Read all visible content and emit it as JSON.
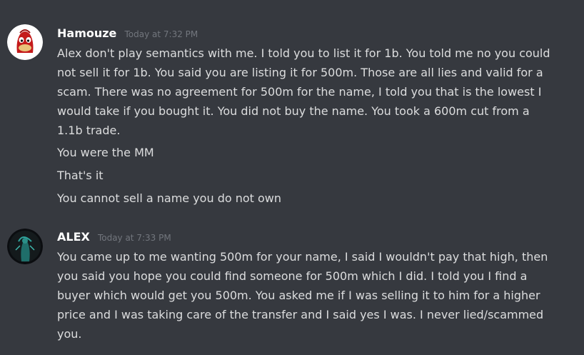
{
  "messages": [
    {
      "author": "Hamouze",
      "timestamp": "Today at 7:32 PM",
      "avatar_icon": "ugandan-knuckles-avatar",
      "paragraphs": [
        {
          "lines": [
            "Alex don't play semantics with me. I told you to list it for 1b. You told me no you could",
            "not sell it for 1b. You said you are listing it for 500m. Those are all lies and valid for a",
            "scam. There was no agreement for 500m for the name, I told you that is the lowest I",
            "would take if you bought it. You did not buy the name. You took a 600m cut from a",
            "1.1b trade."
          ]
        },
        {
          "lines": [
            "You were the MM"
          ]
        },
        {
          "lines": [
            "That's it"
          ]
        },
        {
          "lines": [
            "You cannot sell a name you do not own"
          ]
        }
      ]
    },
    {
      "author": "ALEX",
      "timestamp": "Today at 7:33 PM",
      "avatar_icon": "dark-figure-avatar",
      "paragraphs": [
        {
          "lines": [
            "You came up to me wanting 500m for your name, I said I wouldn't pay that high, then",
            "you said you hope you could find someone for 500m which I did.  I told you I find a",
            "buyer which would get you 500m. You asked me if I was selling it to him for a higher",
            "price and I was taking care of the transfer and I said yes I was. I never lied/scammed",
            "you."
          ]
        }
      ]
    }
  ],
  "colors": {
    "background": "#36393f",
    "author": "#ffffff",
    "timestamp": "#72767d",
    "text": "#dcddde"
  }
}
